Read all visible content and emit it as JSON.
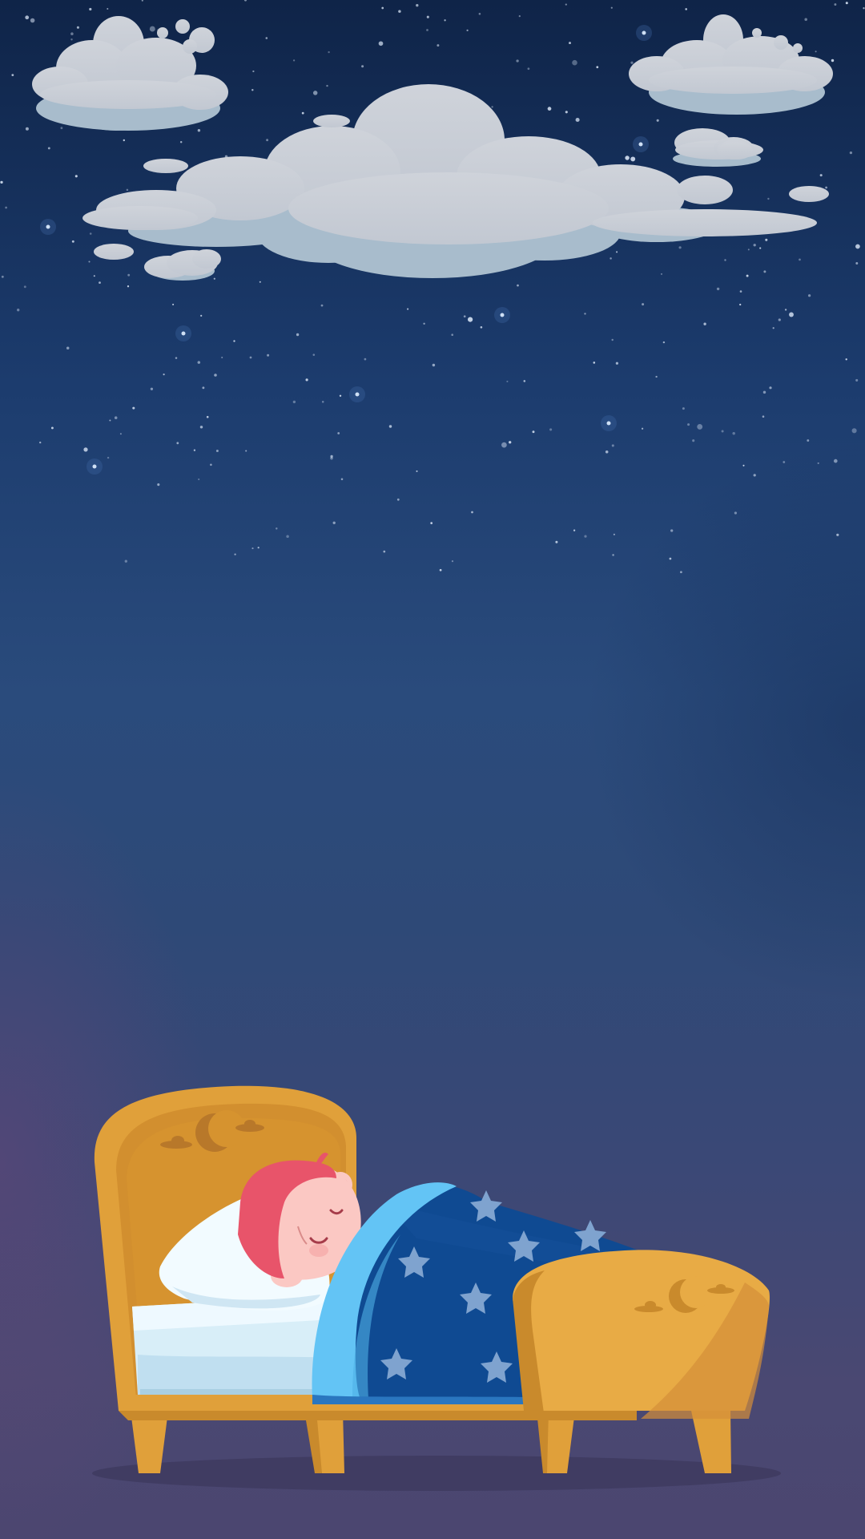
{
  "scene": {
    "description_icon": "sleeping-child-in-bed",
    "colors": {
      "sky_top": "#0f2448",
      "sky_bottom": "#4b4670",
      "cloud": "#c6ccd6",
      "cloud_shadow": "#a9bccd",
      "bed_wood": "#e0a03a",
      "bed_wood_light": "#e8ab45",
      "bed_wood_dark": "#c98a2c",
      "blanket": "#0f4a92",
      "blanket_edge": "#63c4f5",
      "blanket_star": "#7fa3cf",
      "mattress": "#d8eef8",
      "pillow": "#f2fbff",
      "hair": "#e8546a",
      "skin": "#fbc8c3"
    }
  }
}
